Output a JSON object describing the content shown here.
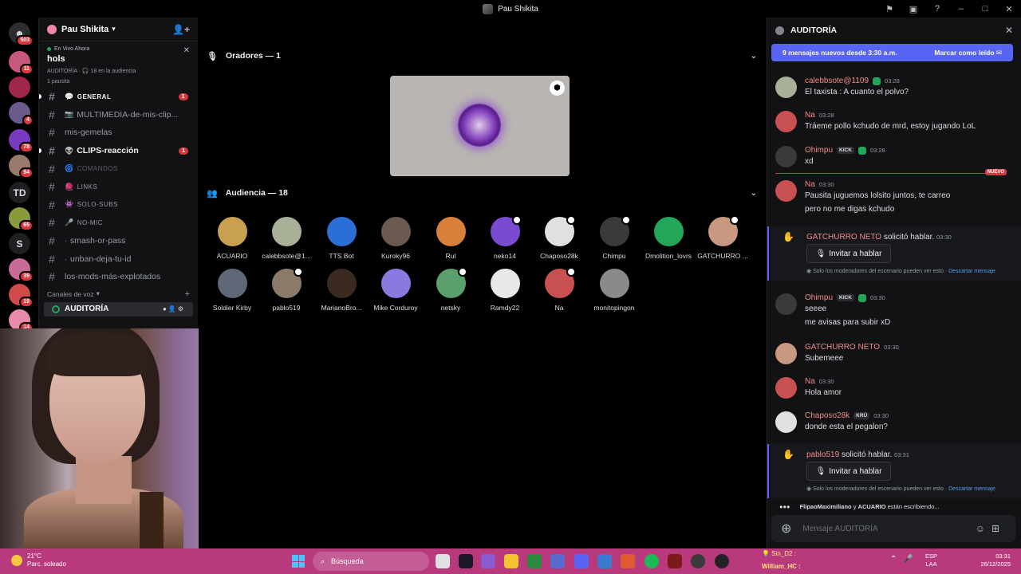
{
  "window": {
    "title": "Pau Shikita"
  },
  "rail": {
    "home_badge": "503",
    "servers": [
      {
        "badge": "11",
        "color": "#c7587c"
      },
      {
        "badge": "",
        "color": "#a0264a"
      },
      {
        "badge": "4",
        "color": "#6a5a8a"
      },
      {
        "badge": "78",
        "color": "#7a3ac0"
      },
      {
        "badge": "94",
        "color": "#9a7a6a"
      },
      {
        "label": "TD"
      },
      {
        "badge": "65",
        "color": "#8a9a3a"
      },
      {
        "label": "S"
      },
      {
        "badge": "39",
        "color": "#c86a9a"
      },
      {
        "badge": "19",
        "color": "#d04a4a"
      },
      {
        "badge": "14",
        "color": "#e88aaa"
      }
    ]
  },
  "server": {
    "name": "Pau Shikita"
  },
  "event": {
    "live_label": "En Vivo Ahora",
    "name": "hols",
    "meta": "AUDITORÍA · 🎧 18 en la audiencia",
    "host": "1 pausita"
  },
  "channels": [
    {
      "name": "GENERAL",
      "emoji": "💬",
      "unread": true,
      "count": "1",
      "small": true
    },
    {
      "name": "MULTIMEDIA-de-mis-clip...",
      "emoji": "📷",
      "unread": false,
      "count": "",
      "small": false
    },
    {
      "name": "mis-gemelas",
      "emoji": "",
      "unread": false,
      "count": "",
      "small": false
    },
    {
      "name": "CLIPS-reacción",
      "emoji": "👽",
      "unread": true,
      "count": "1",
      "small": false
    },
    {
      "name": "COMANDOS",
      "emoji": "🌀",
      "unread": false,
      "count": "",
      "small": true,
      "muted": true
    },
    {
      "name": "LINKS",
      "emoji": "🧶",
      "unread": false,
      "count": "",
      "small": true
    },
    {
      "name": "SOLO-SUBS",
      "emoji": "👾",
      "unread": false,
      "count": "",
      "small": true
    },
    {
      "name": "NO-MIC",
      "emoji": "🎤",
      "unread": false,
      "count": "",
      "small": true
    },
    {
      "name": "smash-or-pass",
      "emoji": "·",
      "unread": false,
      "count": "",
      "small": false
    },
    {
      "name": "unban-deja-tu-id",
      "emoji": "·",
      "unread": false,
      "count": "",
      "small": false
    },
    {
      "name": "los-mods-más-explotados",
      "emoji": "",
      "unread": false,
      "count": "",
      "small": false
    }
  ],
  "voice": {
    "header": "Canales de voz",
    "channel": "AUDITORÍA"
  },
  "stage": {
    "speakers_label": "Oradores — 1",
    "audience_label": "Audiencia — 18",
    "audience": [
      {
        "name": "ACUARIO",
        "color": "#c8a050",
        "mod": false
      },
      {
        "name": "calebbsote@1...",
        "color": "#a8b098",
        "mod": false
      },
      {
        "name": "TTS Bot",
        "color": "#2b6fd6",
        "mod": false
      },
      {
        "name": "Kuroky96",
        "color": "#6a5a50",
        "mod": false
      },
      {
        "name": "Rul",
        "color": "#d8803a",
        "mod": false
      },
      {
        "name": "neko14",
        "color": "#7a4ad0",
        "mod": true
      },
      {
        "name": "Chaposo28k",
        "color": "#e0e0e0",
        "mod": true
      },
      {
        "name": "Chimpu",
        "color": "#3a3a3a",
        "mod": true
      },
      {
        "name": "Dmolition_lovrs",
        "color": "#23a55a",
        "mod": false
      },
      {
        "name": "GATCHURRO ...",
        "color": "#c89880",
        "mod": true
      },
      {
        "name": "Soldier Kirby",
        "color": "#606878",
        "mod": false
      },
      {
        "name": "pablo519",
        "color": "#8a7a6a",
        "mod": true
      },
      {
        "name": "MarianoBro...",
        "color": "#3a2a20",
        "mod": false
      },
      {
        "name": "Mike Corduroy",
        "color": "#8a7adf",
        "mod": false
      },
      {
        "name": "netsky",
        "color": "#5aa06a",
        "mod": true
      },
      {
        "name": "Ramdy22",
        "color": "#e8e8e8",
        "mod": false
      },
      {
        "name": "Na",
        "color": "#c85050",
        "mod": true
      },
      {
        "name": "monitopingon",
        "color": "#8a8a8a",
        "mod": false
      }
    ]
  },
  "chat": {
    "title": "AUDITORÍA",
    "new_messages": "9 mensajes nuevos desde 3:30 a.m.",
    "mark_read": "Marcar como leído",
    "new_label": "NUEVO",
    "messages": [
      {
        "author": "calebbsote@1109",
        "color": "#f28a8a",
        "time": "03:28",
        "lines": [
          "El taxista : A cuanto el polvo?"
        ],
        "tag": "",
        "shield": true,
        "avatar": "#a8b098"
      },
      {
        "author": "Na",
        "color": "#f28a8a",
        "time": "03:28",
        "lines": [
          "Tráeme pollo kchudo de mrd, estoy jugando LoL"
        ],
        "tag": "",
        "shield": false,
        "avatar": "#c85050"
      },
      {
        "author": "Ohimpu",
        "color": "#f28a8a",
        "time": "03:28",
        "lines": [
          "xd"
        ],
        "tag": "KICK",
        "shield": true,
        "avatar": "#3a3a3a"
      },
      {
        "author": "Na",
        "color": "#f28a8a",
        "time": "03:30",
        "lines": [
          "Pausita juguemos lolsito juntos, te carreo",
          "pero no me digas kchudo"
        ],
        "tag": "",
        "shield": false,
        "avatar": "#c85050"
      },
      {
        "author": "Ohimpu",
        "color": "#f28a8a",
        "time": "03:30",
        "lines": [
          "seeee",
          "me avisas para subir xD"
        ],
        "tag": "KICK",
        "shield": true,
        "avatar": "#3a3a3a"
      },
      {
        "author": "GATCHURRO NETO",
        "color": "#f28a8a",
        "time": "03:30",
        "lines": [
          "Subemeee"
        ],
        "tag": "",
        "shield": false,
        "avatar": "#c89880"
      },
      {
        "author": "Na",
        "color": "#f28a8a",
        "time": "03:30",
        "lines": [
          "Hola amor"
        ],
        "tag": "",
        "shield": false,
        "avatar": "#c85050"
      },
      {
        "author": "Chaposo28k",
        "color": "#f28a8a",
        "time": "03:30",
        "lines": [
          "donde esta el pegalon?"
        ],
        "tag": "KRÜ",
        "shield": false,
        "avatar": "#e0e0e0"
      }
    ],
    "requests": [
      {
        "who": "GATCHURRO NETO",
        "action": "solicitó hablar.",
        "time": "03:30"
      },
      {
        "who": "pablo519",
        "action": "solicitó hablar.",
        "time": "03:31"
      }
    ],
    "invite_label": "Invitar a hablar",
    "note": "Solo los moderadores del escenario pueden ver esto ·",
    "discard": "Descartar mensaje",
    "typing_names": "FlipaoMaximiliano",
    "typing_and": "y",
    "typing_name2": "ACUARIO",
    "typing_suffix": "están escribiendo...",
    "composer_placeholder": "Mensaje AUDITORÍA"
  },
  "taskbar": {
    "temp": "21°C",
    "weather": "Parc. soleado",
    "search": "Búsqueda",
    "tray_line1": "💡 Sin_D2 :",
    "tray_line2": "William_HC :",
    "lang1": "ESP",
    "lang2": "LAA",
    "time": "03:31",
    "date": "26/12/2025"
  }
}
